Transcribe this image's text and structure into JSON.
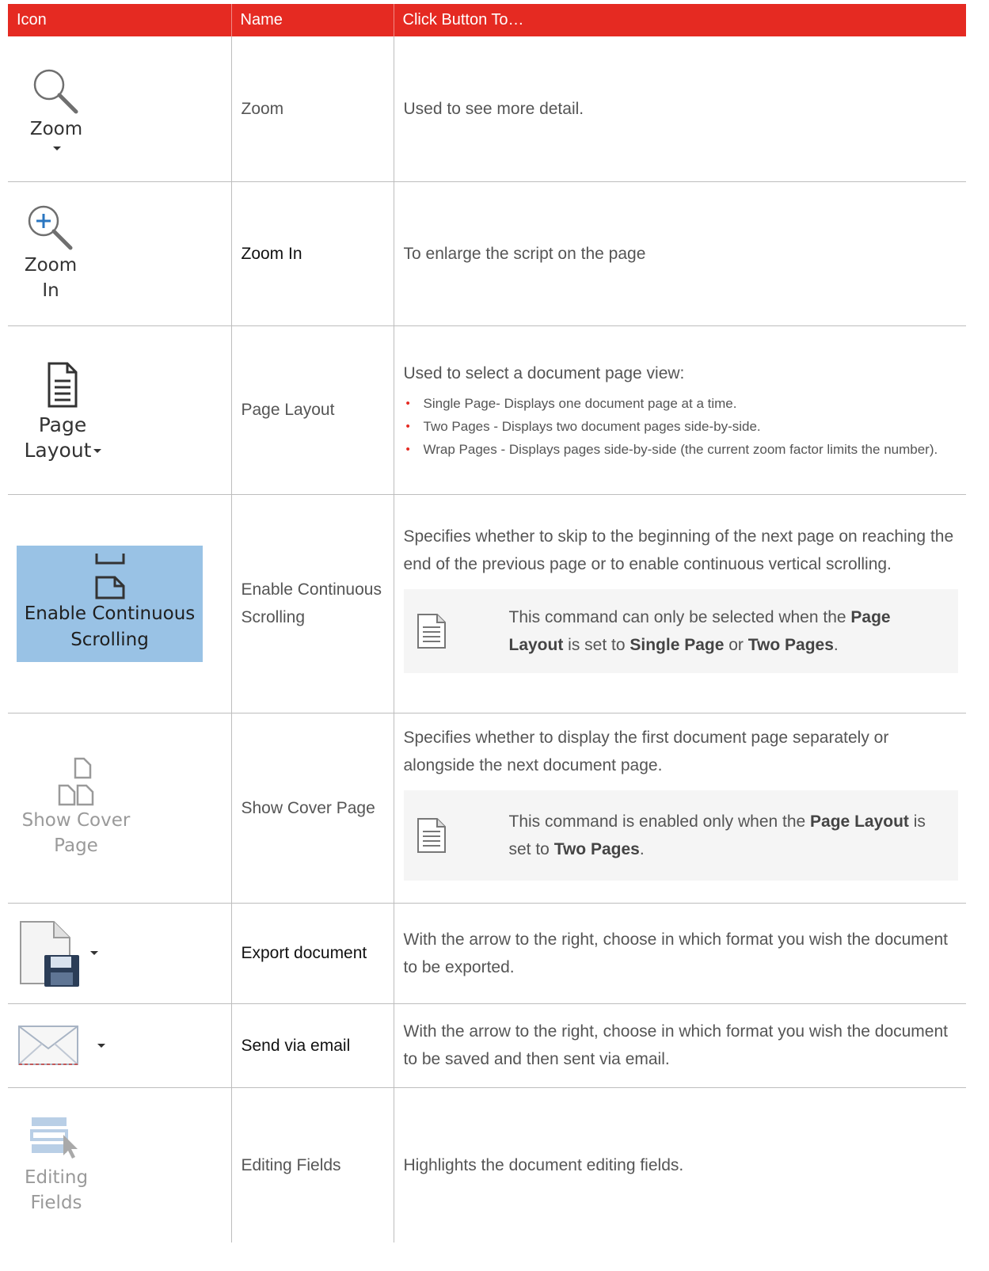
{
  "headers": {
    "icon": "Icon",
    "name": "Name",
    "action": "Click Button To…"
  },
  "rows": [
    {
      "icon": "zoom-icon",
      "icon_label": "Zoom",
      "name": "Zoom",
      "description": "Used to see more detail."
    },
    {
      "icon": "zoom-in-icon",
      "icon_label_1": "Zoom",
      "icon_label_2": "In",
      "name": "Zoom In",
      "description": "To enlarge the script on the page"
    },
    {
      "icon": "page-layout-icon",
      "icon_label_1": "Page",
      "icon_label_2": "Layout",
      "name": "Page Layout",
      "description": "Used to select a document page view:",
      "bullets": [
        "Single Page- Displays one document page at a time.",
        "Two Pages - Displays two document pages side-by-side.",
        "Wrap Pages - Displays pages side-by-side (the current zoom factor limits the number)."
      ]
    },
    {
      "icon": "continuous-scroll-icon",
      "icon_label_1": "Enable Continuous",
      "icon_label_2": "Scrolling",
      "name": "Enable Continuous Scrolling",
      "description": "Specifies whether to skip to the beginning of the next page on reaching the end of the previous page or to enable continuous vertical scrolling.",
      "note": {
        "t1": "This command can only be selected when the ",
        "b1": "Page Layout",
        "t2": " is set to ",
        "b2": "Single Page",
        "t3": " or ",
        "b3": "Two Pages",
        "t4": "."
      }
    },
    {
      "icon": "cover-page-icon",
      "icon_label_1": "Show Cover",
      "icon_label_2": "Page",
      "name": "Show Cover Page",
      "description": "Specifies whether to display the first document page separately or alongside the next document page.",
      "note": {
        "t1": "This command is enabled only when the ",
        "b1": "Page Layout",
        "t2": " is set to ",
        "b2": "Two Pages",
        "t3": "."
      }
    },
    {
      "icon": "export-document-icon",
      "name": "Export document",
      "description": "With the arrow to the right, choose in which format you wish the document to be exported."
    },
    {
      "icon": "email-icon",
      "name": "Send via email",
      "description": "With the arrow to the right, choose in which format you wish the document to be saved and then sent via email."
    },
    {
      "icon": "editing-fields-icon",
      "icon_label_1": "Editing",
      "icon_label_2": "Fields",
      "name": "Editing Fields",
      "description": "Highlights the document editing fields."
    }
  ],
  "colors": {
    "header_bg": "#e52a22",
    "selected_icon_bg": "#99c2e5",
    "note_bg": "#f5f5f5"
  }
}
